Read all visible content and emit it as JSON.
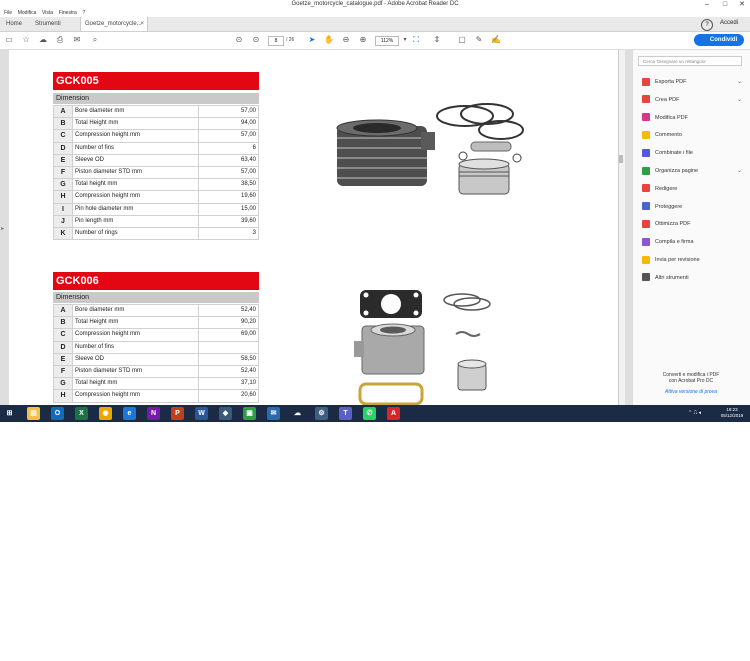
{
  "window": {
    "title": "Goetze_motorcycle_catalogue.pdf - Adobe Acrobat Reader DC",
    "controls": {
      "minimize": "–",
      "maximize": "□",
      "close": "✕"
    }
  },
  "menu": [
    "File",
    "Modifica",
    "Vista",
    "Finestra",
    "?"
  ],
  "tabs": {
    "home": "Home",
    "tools": "Strumenti",
    "doc": "Goetze_motorcycle..."
  },
  "header": {
    "help": "?",
    "bell": "🔔",
    "signin": "Accedi"
  },
  "toolbar": {
    "page_current": "8",
    "page_total": "/ 26",
    "zoom": "112%",
    "share_label": "Condividi"
  },
  "products": [
    {
      "code": "GCK005",
      "dimension_label": "Dimension",
      "rows": [
        {
          "letter": "A",
          "label": "Bore diameter mm",
          "value": "57,00"
        },
        {
          "letter": "B",
          "label": "Total Height mm",
          "value": "94,00"
        },
        {
          "letter": "C",
          "label": "Compression height mm",
          "value": "57,00"
        },
        {
          "letter": "D",
          "label": "Number of fins",
          "value": "6"
        },
        {
          "letter": "E",
          "label": "Sleeve OD",
          "value": "63,40"
        },
        {
          "letter": "F",
          "label": "Piston diameter STD mm",
          "value": "57,00"
        },
        {
          "letter": "G",
          "label": "Total height mm",
          "value": "38,50"
        },
        {
          "letter": "H",
          "label": "Compression height mm",
          "value": "19,60"
        },
        {
          "letter": "I",
          "label": "Pin hole diameter mm",
          "value": "15,00"
        },
        {
          "letter": "J",
          "label": "Pin length mm",
          "value": "39,60"
        },
        {
          "letter": "K",
          "label": "Number of rings",
          "value": "3"
        }
      ]
    },
    {
      "code": "GCK006",
      "dimension_label": "Dimension",
      "rows": [
        {
          "letter": "A",
          "label": "Bore diameter mm",
          "value": "52,40"
        },
        {
          "letter": "B",
          "label": "Total Height mm",
          "value": "90,20"
        },
        {
          "letter": "C",
          "label": "Compression height mm",
          "value": "69,00"
        },
        {
          "letter": "D",
          "label": "Number of fins",
          "value": ""
        },
        {
          "letter": "E",
          "label": "Sleeve OD",
          "value": "58,50"
        },
        {
          "letter": "F",
          "label": "Piston diameter STD mm",
          "value": "52,40"
        },
        {
          "letter": "G",
          "label": "Total height mm",
          "value": "37,10"
        },
        {
          "letter": "H",
          "label": "Compression height mm",
          "value": "20,60"
        }
      ]
    }
  ],
  "sidepanel": {
    "search_placeholder": "Cerca 'Disegnare un rettangolo'",
    "tools": [
      {
        "label": "Esporta PDF",
        "color": "#e8433c",
        "chevron": true
      },
      {
        "label": "Crea PDF",
        "color": "#e8433c",
        "chevron": true
      },
      {
        "label": "Modifica PDF",
        "color": "#d7378a",
        "chevron": false
      },
      {
        "label": "Commento",
        "color": "#f5b80b",
        "chevron": false
      },
      {
        "label": "Combinate i file",
        "color": "#5357d9",
        "chevron": false
      },
      {
        "label": "Organizza pagine",
        "color": "#2ea043",
        "chevron": true
      },
      {
        "label": "Redigere",
        "color": "#e8433c",
        "chevron": false
      },
      {
        "label": "Proteggere",
        "color": "#4b62d1",
        "chevron": false
      },
      {
        "label": "Ottimizza PDF",
        "color": "#e8433c",
        "chevron": false
      },
      {
        "label": "Compila e firma",
        "color": "#8f54d6",
        "chevron": false
      },
      {
        "label": "Invia per revisione",
        "color": "#f5b80b",
        "chevron": false
      },
      {
        "label": "Altri strumenti",
        "color": "#555555",
        "chevron": false
      }
    ],
    "promo_line1": "Converti e modifica i PDF",
    "promo_line2": "con Acrobat Pro DC",
    "promo_link": "Attiva versione di prova"
  },
  "taskbar": {
    "time": "18:23",
    "date": "05/12/2019",
    "apps": [
      {
        "name": "start",
        "color": "#1c2b45",
        "glyph": "⊞"
      },
      {
        "name": "explorer",
        "color": "#f3c244",
        "glyph": "▤"
      },
      {
        "name": "outlook",
        "color": "#0f6cbd",
        "glyph": "O"
      },
      {
        "name": "excel",
        "color": "#1e7145",
        "glyph": "X"
      },
      {
        "name": "chrome",
        "color": "#e9a700",
        "glyph": "◉"
      },
      {
        "name": "edge",
        "color": "#1a78d6",
        "glyph": "e"
      },
      {
        "name": "onenote",
        "color": "#7719aa",
        "glyph": "N"
      },
      {
        "name": "powerpoint",
        "color": "#c43e1c",
        "glyph": "P"
      },
      {
        "name": "word",
        "color": "#2b579a",
        "glyph": "W"
      },
      {
        "name": "app-generic",
        "color": "#3c5a78",
        "glyph": "◆"
      },
      {
        "name": "store",
        "color": "#2e9e44",
        "glyph": "▣"
      },
      {
        "name": "mail",
        "color": "#2a6bb0",
        "glyph": "✉"
      },
      {
        "name": "onedrive",
        "color": "#1c2b45",
        "glyph": "☁"
      },
      {
        "name": "settings",
        "color": "#3f5f7f",
        "glyph": "⚙"
      },
      {
        "name": "teams",
        "color": "#5b5fc7",
        "glyph": "T"
      },
      {
        "name": "whatsapp",
        "color": "#25d366",
        "glyph": "✆"
      },
      {
        "name": "acrobat",
        "color": "#d7262b",
        "glyph": "A"
      }
    ]
  }
}
